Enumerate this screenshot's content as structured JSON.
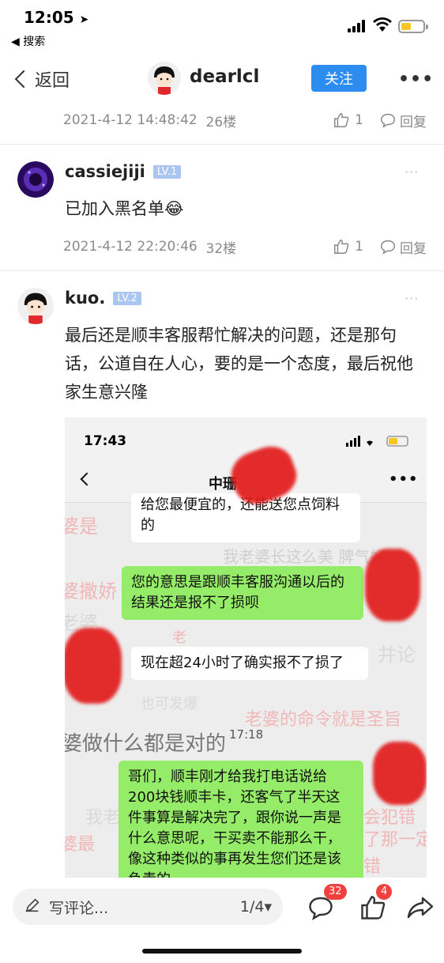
{
  "status_bar": {
    "time": "12:05",
    "back_app": "◀ 搜索"
  },
  "nav": {
    "back_label": "返回",
    "username": "dearlcl",
    "follow_label": "关注",
    "more": "•••"
  },
  "posts": [
    {
      "date": "2021-4-12 14:48:42",
      "floor": "26楼",
      "likes": "1",
      "reply_label": "回复"
    },
    {
      "username": "cassiejiji",
      "level": "LV.1",
      "text": "已加入黑名单😂",
      "date": "2021-4-12 22:20:46",
      "floor": "32楼",
      "likes": "1",
      "reply_label": "回复",
      "more": "···"
    },
    {
      "username": "kuo.",
      "level": "LV.2",
      "text": "最后还是顺丰客服帮忙解决的问题，还是那句话，公道自在人心，要的是一个态度，最后祝他家生意兴隆",
      "more": "···"
    }
  ],
  "screenshot": {
    "time": "17:43",
    "title": "中珊",
    "more": "•••",
    "bg_texts": [
      "婆是",
      "我老婆长这么美 脾气好",
      "婆撒娇",
      "老婆",
      "老",
      "并论",
      "也可发爆",
      "老婆的命令就是圣旨",
      "婆做什么都是对的",
      "我老",
      "婆最",
      "会犯错",
      "了那一定",
      "错"
    ],
    "messages": [
      {
        "type": "white",
        "text": "给您最便宜的，还能送您点饲料的"
      },
      {
        "type": "green",
        "text": "您的意思是跟顺丰客服沟通以后的结果还是报不了损呗"
      },
      {
        "type": "white",
        "text": "现在超24小时了确实报不了损了"
      },
      {
        "type": "green",
        "text": "哥们，顺丰刚才给我打电话说给200块钱顺丰卡，还客气了半天这件事算是解决完了，跟你说一声是什么意思呢，干买卖不能那么干，像这种类似的事再发生您们还是该负责的"
      }
    ],
    "timestamp": "17:18"
  },
  "bottom_bar": {
    "comment_placeholder": "写评论...",
    "page": "1/4▾",
    "comment_count": "32",
    "like_count": "4"
  }
}
